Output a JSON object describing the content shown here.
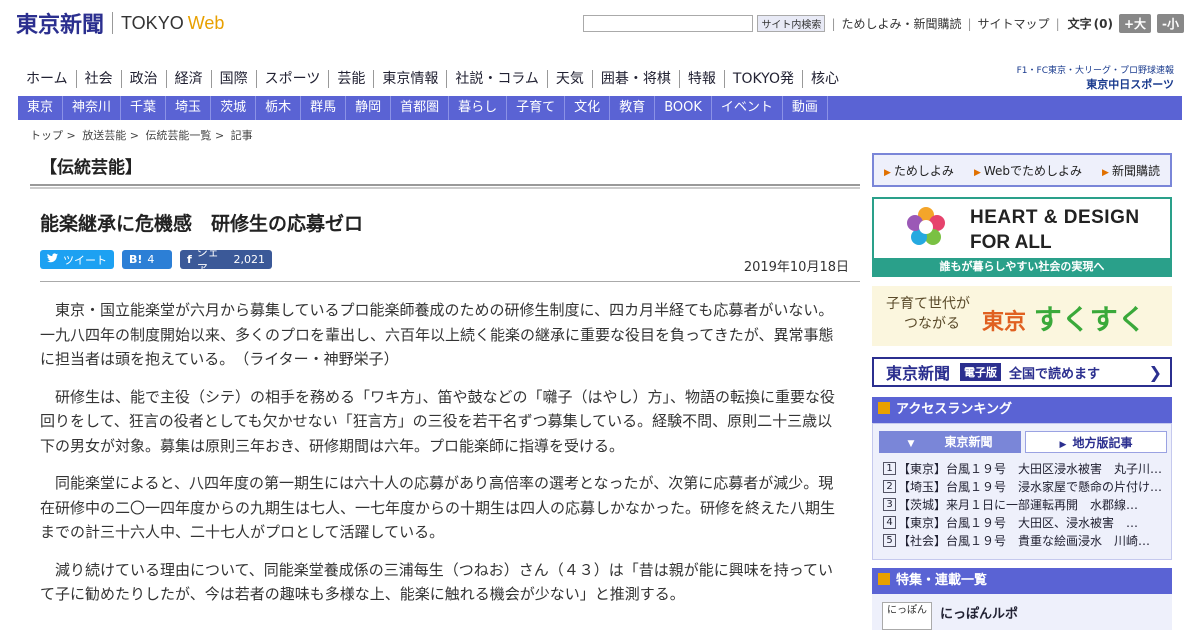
{
  "header": {
    "logo_ja": "東京新聞",
    "logo_tokyo": "TOKYO",
    "logo_web": "Web",
    "search_button": "サイト内検索",
    "links": [
      "ためしよみ・新聞購読",
      "サイトマップ"
    ],
    "font_size_label": "文字",
    "font_size_count": "(0)",
    "size_up": "+大",
    "size_down": "-小"
  },
  "nav_main": [
    "ホーム",
    "社会",
    "政治",
    "経済",
    "国際",
    "スポーツ",
    "芸能",
    "東京情報",
    "社説・コラム",
    "天気",
    "囲碁・将棋",
    "特報",
    "TOKYO発",
    "核心"
  ],
  "chunichi": {
    "sub": "F1・FC東京・大リーグ・プロ野球速報",
    "main": "東京中日スポーツ"
  },
  "nav_region": [
    "東京",
    "神奈川",
    "千葉",
    "埼玉",
    "茨城",
    "栃木",
    "群馬",
    "静岡",
    "首都圏",
    "暮らし",
    "子育て",
    "文化",
    "教育",
    "BOOK",
    "イベント",
    "動画"
  ],
  "breadcrumb": [
    "トップ",
    ">",
    "放送芸能",
    ">",
    "伝統芸能一覧",
    ">",
    "記事"
  ],
  "article": {
    "section": "【伝統芸能】",
    "headline": "能楽継承に危機感　研修生の応募ゼロ",
    "share": {
      "tweet": "ツイート",
      "hatena_icon": "B!",
      "hatena_count": "4",
      "fb_icon": "f",
      "fb_label": "シェア",
      "fb_count": "2,021"
    },
    "date": "2019年10月18日",
    "paragraphs": [
      "東京・国立能楽堂が六月から募集しているプロ能楽師養成のための研修生制度に、四カ月半経ても応募者がいない。一九八四年の制度開始以来、多くのプロを輩出し、六百年以上続く能楽の継承に重要な役目を負ってきたが、異常事態に担当者は頭を抱えている。　（ライター・神野栄子）",
      "研修生は、能で主役（シテ）の相手を務める「ワキ方」、笛や鼓などの「囃子（はやし）方」、物語の転換に重要な役回りをして、狂言の役者としても欠かせない「狂言方」の三役を若干名ずつ募集している。経験不問、原則二十三歳以下の男女が対象。募集は原則三年おき、研修期間は六年。プロ能楽師に指導を受ける。",
      "同能楽堂によると、八四年度の第一期生には六十人の応募があり高倍率の選考となったが、次第に応募者が減少。現在研修中の二〇一四年度からの九期生は七人、一七年度からの十期生は四人の応募しかなかった。研修を終えた八期生までの計三十六人中、二十七人がプロとして活躍している。",
      "減り続けている理由について、同能楽堂養成係の三浦每生（つねお）さん（４３）は「昔は親が能に興味を持っていて子に勧めたりしたが、今は若者の趣味も多様な上、能楽に触れる機会が少ない」と推測する。"
    ]
  },
  "sidebar": {
    "tameshi": [
      "ためしよみ",
      "Webでためしよみ",
      "新聞購読"
    ],
    "heart": {
      "title1": "HEART & DESIGN",
      "title2": "FOR ALL",
      "caption": "誰もが暮らしやすい社会の実現へ"
    },
    "sukusuku": {
      "sub1": "子育て世代が",
      "sub2": "つながる",
      "tokyo": "東京",
      "suku": "すくすく"
    },
    "denshi": {
      "logo": "東京新聞",
      "badge": "電子版",
      "text": "全国で読めます",
      "arrow": "❯"
    },
    "ranking": {
      "title": "アクセスランキング",
      "tabs": [
        "東京新聞",
        "地方版記事"
      ],
      "items": [
        {
          "num": "1",
          "text": "【東京】台風１９号　大田区浸水被害　丸子川…"
        },
        {
          "num": "2",
          "text": "【埼玉】台風１９号　浸水家屋で懸命の片付け…"
        },
        {
          "num": "3",
          "text": "【茨城】来月１日に一部運転再開　水郡線…"
        },
        {
          "num": "4",
          "text": "【東京】台風１９号　大田区、浸水被害　…"
        },
        {
          "num": "5",
          "text": "【社会】台風１９号　貴重な絵画浸水　川崎…"
        }
      ]
    },
    "features": {
      "title": "特集・連載一覧",
      "thumb": "にっぽん",
      "item": "にっぽんルポ"
    }
  }
}
